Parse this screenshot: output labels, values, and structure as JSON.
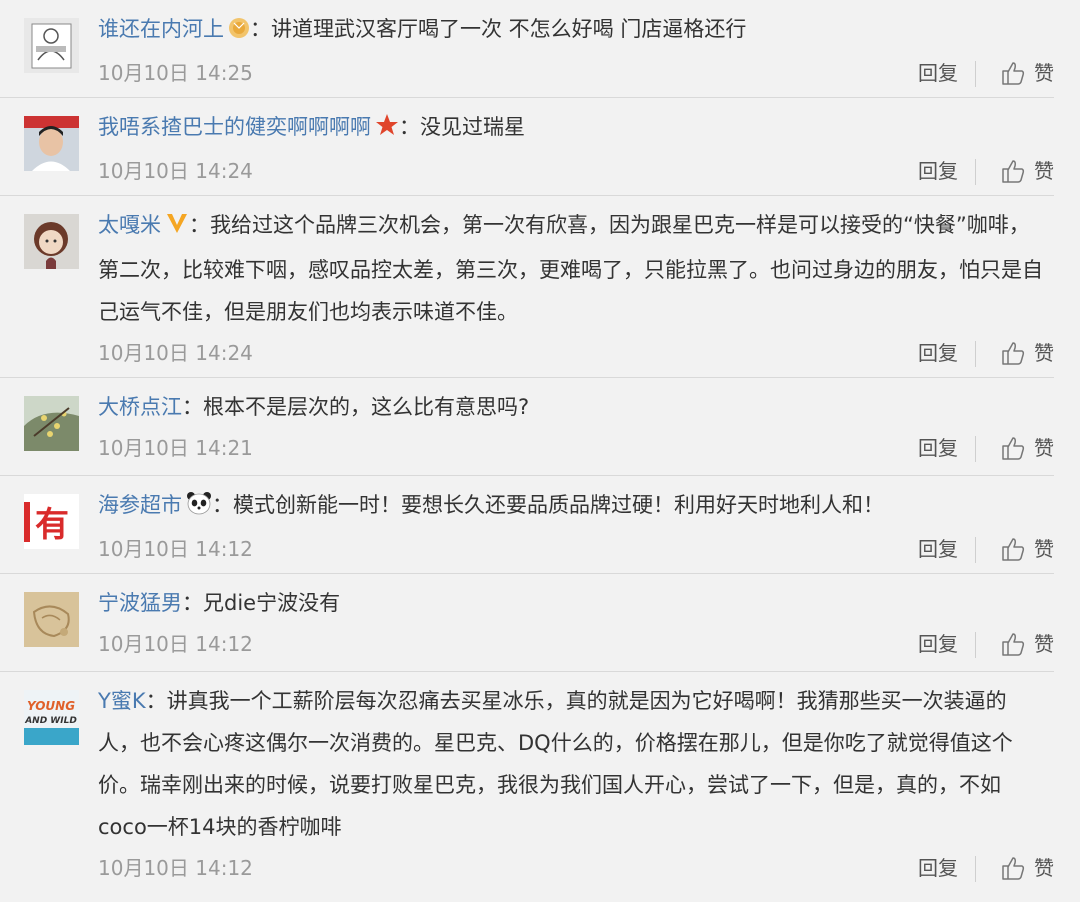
{
  "comments": [
    {
      "user": "谁还在内河上",
      "badge": "bronze-medal-icon",
      "text": "讲道理武汉客厅喝了一次 不怎么好喝  门店逼格还行",
      "time": "10月10日 14:25",
      "reply": "回复",
      "like": "赞"
    },
    {
      "user": "我唔系揸巴士的健奕啊啊啊啊",
      "badge": "star-icon",
      "text": "没见过瑞星",
      "time": "10月10日 14:24",
      "reply": "回复",
      "like": "赞"
    },
    {
      "user": "太嘎米",
      "badge": "verified-v-icon",
      "text": "我给过这个品牌三次机会，第一次有欣喜，因为跟星巴克一样是可以接受的“快餐”咖啡，第二次，比较难下咽，感叹品控太差，第三次，更难喝了，只能拉黑了。也问过身边的朋友，怕只是自己运气不佳，但是朋友们也均表示味道不佳。",
      "time": "10月10日 14:24",
      "reply": "回复",
      "like": "赞"
    },
    {
      "user": "大桥点江",
      "badge": "",
      "text": "根本不是层次的，这么比有意思吗?",
      "time": "10月10日 14:21",
      "reply": "回复",
      "like": "赞"
    },
    {
      "user": "海参超市",
      "badge": "panda-icon",
      "text": "模式创新能一时！要想长久还要品质品牌过硬！利用好天时地利人和！",
      "time": "10月10日 14:12",
      "reply": "回复",
      "like": "赞"
    },
    {
      "user": "宁波猛男",
      "badge": "",
      "text": "兄die宁波没有",
      "time": "10月10日 14:12",
      "reply": "回复",
      "like": "赞"
    },
    {
      "user": "Y蜜K",
      "badge": "",
      "text": "讲真我一个工薪阶层每次忍痛去买星冰乐，真的就是因为它好喝啊！我猜那些买一次装逼的人，也不会心疼这偶尔一次消费的。星巴克、DQ什么的，价格摆在那儿，但是你吃了就觉得值这个价。瑞幸刚出来的时候，说要打败星巴克，我很为我们国人开心，尝试了一下，但是，真的，不如coco一杯14块的香柠咖啡",
      "time": "10月10日 14:12",
      "reply": "回复",
      "like": "赞"
    }
  ],
  "avatars": {
    "a5_char": "有",
    "a7_line1": "YOUNG",
    "a7_line2": "AND WILD"
  },
  "colors": {
    "username": "#4a7ab0",
    "meta": "#9a9a9a",
    "background": "#f2f2f2"
  }
}
